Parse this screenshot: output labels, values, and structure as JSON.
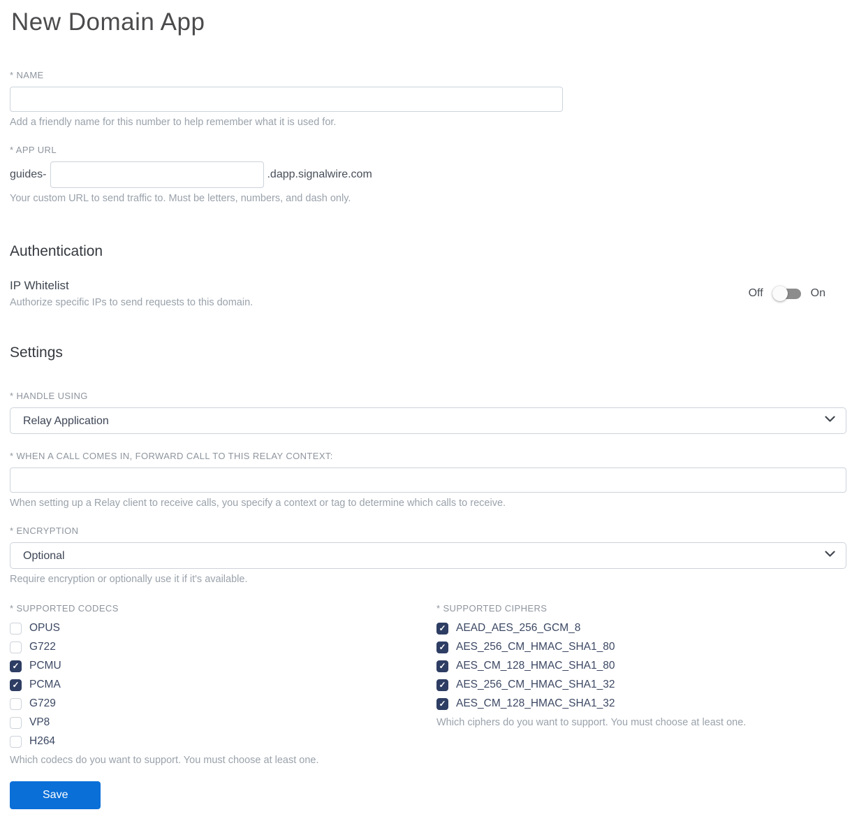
{
  "page": {
    "title": "New Domain App"
  },
  "name_field": {
    "label": "* NAME",
    "value": "",
    "helper": "Add a friendly name for this number to help remember what it is used for."
  },
  "app_url_field": {
    "label": "* APP URL",
    "prefix": "guides-",
    "value": "",
    "suffix": ".dapp.signalwire.com",
    "helper": "Your custom URL to send traffic to. Must be letters, numbers, and dash only."
  },
  "authentication": {
    "heading": "Authentication",
    "ip_whitelist": {
      "label": "IP Whitelist",
      "helper": "Authorize specific IPs to send requests to this domain.",
      "toggle": {
        "off_label": "Off",
        "on_label": "On",
        "state": "off"
      }
    }
  },
  "settings": {
    "heading": "Settings",
    "handle_using": {
      "label": "* HANDLE USING",
      "selected": "Relay Application"
    },
    "relay_context": {
      "label": "* WHEN A CALL COMES IN, FORWARD CALL TO THIS RELAY CONTEXT:",
      "value": "",
      "helper": "When setting up a Relay client to receive calls, you specify a context or tag to determine which calls to receive."
    },
    "encryption": {
      "label": "* ENCRYPTION",
      "selected": "Optional",
      "helper": "Require encryption or optionally use it if it's available."
    },
    "codecs": {
      "label": "* SUPPORTED CODECS",
      "helper": "Which codecs do you want to support. You must choose at least one.",
      "options": [
        {
          "label": "OPUS",
          "checked": false
        },
        {
          "label": "G722",
          "checked": false
        },
        {
          "label": "PCMU",
          "checked": true
        },
        {
          "label": "PCMA",
          "checked": true
        },
        {
          "label": "G729",
          "checked": false
        },
        {
          "label": "VP8",
          "checked": false
        },
        {
          "label": "H264",
          "checked": false
        }
      ]
    },
    "ciphers": {
      "label": "* SUPPORTED CIPHERS",
      "helper": "Which ciphers do you want to support. You must choose at least one.",
      "options": [
        {
          "label": "AEAD_AES_256_GCM_8",
          "checked": true
        },
        {
          "label": "AES_256_CM_HMAC_SHA1_80",
          "checked": true
        },
        {
          "label": "AES_CM_128_HMAC_SHA1_80",
          "checked": true
        },
        {
          "label": "AES_256_CM_HMAC_SHA1_32",
          "checked": true
        },
        {
          "label": "AES_CM_128_HMAC_SHA1_32",
          "checked": true
        }
      ]
    }
  },
  "actions": {
    "save_label": "Save"
  },
  "colors": {
    "save_button_blue": "#0b6fd8",
    "checkbox_navy": "#2e3d63",
    "toggle_track_gray": "#8d8d8d",
    "input_border": "#ccd3db",
    "label_gray": "#8e959e",
    "helper_gray": "#9aa2ab"
  }
}
